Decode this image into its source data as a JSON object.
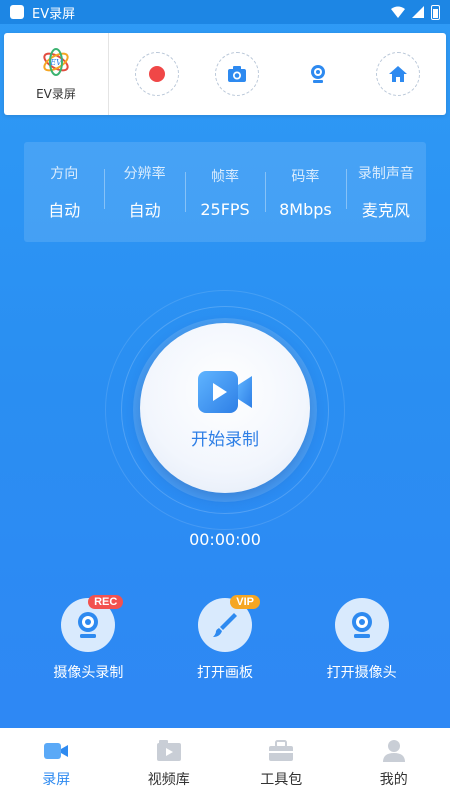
{
  "status_bar": {
    "app_name": "EV录屏"
  },
  "header": {
    "logo_text": "EV录屏",
    "quick_actions": [
      {
        "icon": "record-icon",
        "color": "#f04747"
      },
      {
        "icon": "camera-icon",
        "color": "#2e8af0"
      },
      {
        "icon": "webcam-icon",
        "color": "#2e8af0"
      },
      {
        "icon": "home-icon",
        "color": "#2e8af0"
      }
    ]
  },
  "settings": [
    {
      "label": "方向",
      "value": "自动"
    },
    {
      "label": "分辨率",
      "value": "自动"
    },
    {
      "label": "帧率",
      "value": "25FPS"
    },
    {
      "label": "码率",
      "value": "8Mbps"
    },
    {
      "label": "录制声音",
      "value": "麦克风"
    }
  ],
  "record": {
    "label": "开始录制",
    "timer": "00:00:00"
  },
  "features": [
    {
      "label": "摄像头录制",
      "badge": "REC",
      "icon": "webcam-record-icon"
    },
    {
      "label": "打开画板",
      "badge": "VIP",
      "icon": "brush-icon"
    },
    {
      "label": "打开摄像头",
      "badge": "",
      "icon": "webcam-icon"
    }
  ],
  "nav": [
    {
      "label": "录屏",
      "icon": "screen-record-icon",
      "active": true
    },
    {
      "label": "视频库",
      "icon": "video-library-icon",
      "active": false
    },
    {
      "label": "工具包",
      "icon": "toolbox-icon",
      "active": false
    },
    {
      "label": "我的",
      "icon": "profile-icon",
      "active": false
    }
  ],
  "colors": {
    "accent": "#2e8af0",
    "background": "#2f8ff2",
    "record_red": "#f04747",
    "rec_badge": "#f2524f",
    "vip_badge": "#f5a623"
  }
}
